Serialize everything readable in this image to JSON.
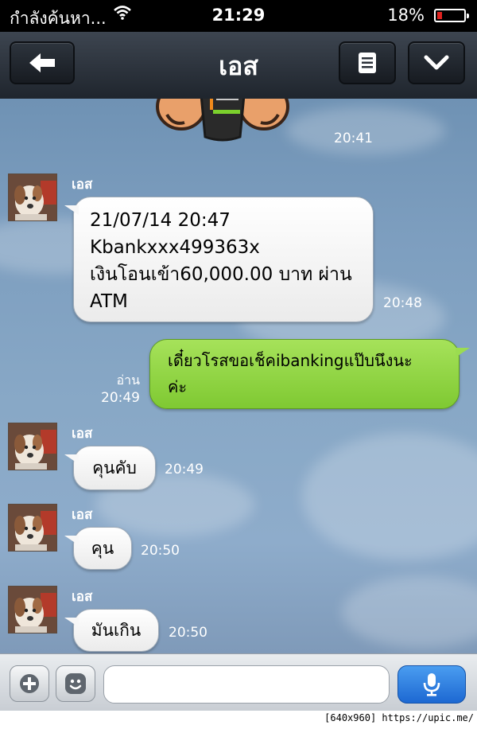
{
  "status_bar": {
    "carrier": "กำลังค้นหา...",
    "time": "21:29",
    "battery": "18%",
    "battery_level": 0.18
  },
  "header": {
    "title": "เอส",
    "back_icon": "arrow-left-icon",
    "menu_icon": "list-icon",
    "expand_icon": "chevron-down-icon"
  },
  "chat": {
    "sticker_time": "20:41",
    "messages": [
      {
        "sender": "เอส",
        "text": "  21/07/14 20:47\nKbankxxx499363x\nเงินโอนเข้า60,000.00 บาท ผ่าน\nATM",
        "time": "20:48"
      },
      {
        "sender": "me",
        "text": "เดี๋ยวโรสขอเช็คibankingแป๊บนึงนะ\nค่ะ",
        "read": "อ่าน",
        "time": "20:49"
      },
      {
        "sender": "เอส",
        "text": "คุนคับ",
        "time": "20:49"
      },
      {
        "sender": "เอส",
        "text": "คุน",
        "time": "20:50"
      },
      {
        "sender": "เอส",
        "text": "มันเกิน",
        "time": "20:50"
      }
    ]
  },
  "input_bar": {
    "add_icon": "plus-icon",
    "emoji_icon": "smiley-icon",
    "placeholder": "",
    "mic_icon": "microphone-icon"
  },
  "footer": {
    "watermark": "[640x960] https://upic.me/"
  },
  "colors": {
    "nav": "#2a3038",
    "chat_bg": "#7f9fbf",
    "bubble_green": "#8fd345",
    "mic_blue": "#2b7ee0",
    "battery_red": "#e0221f"
  }
}
